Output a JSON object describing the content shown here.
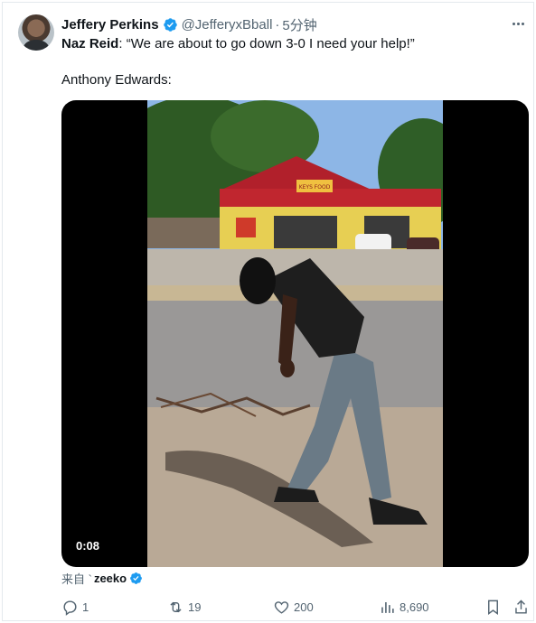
{
  "author": {
    "name": "Jeffery Perkins",
    "handle": "@JefferyxBball",
    "separator": "·",
    "time": "5分钟"
  },
  "tweet": {
    "line1_name": "Naz Reid",
    "line1_text": ": “We are about to go down 3-0 I need your help!”",
    "line2": "Anthony Edwards:"
  },
  "media": {
    "duration": "0:08",
    "sign_text": "KEYS FOOD"
  },
  "source": {
    "prefix": "来自 `",
    "name": "zeeko"
  },
  "actions": {
    "replies": "1",
    "retweets": "19",
    "likes": "200",
    "views": "8,690"
  },
  "colors": {
    "verified": "#1d9bf0",
    "muted_text": "#536471",
    "main_text": "#0f1419"
  }
}
